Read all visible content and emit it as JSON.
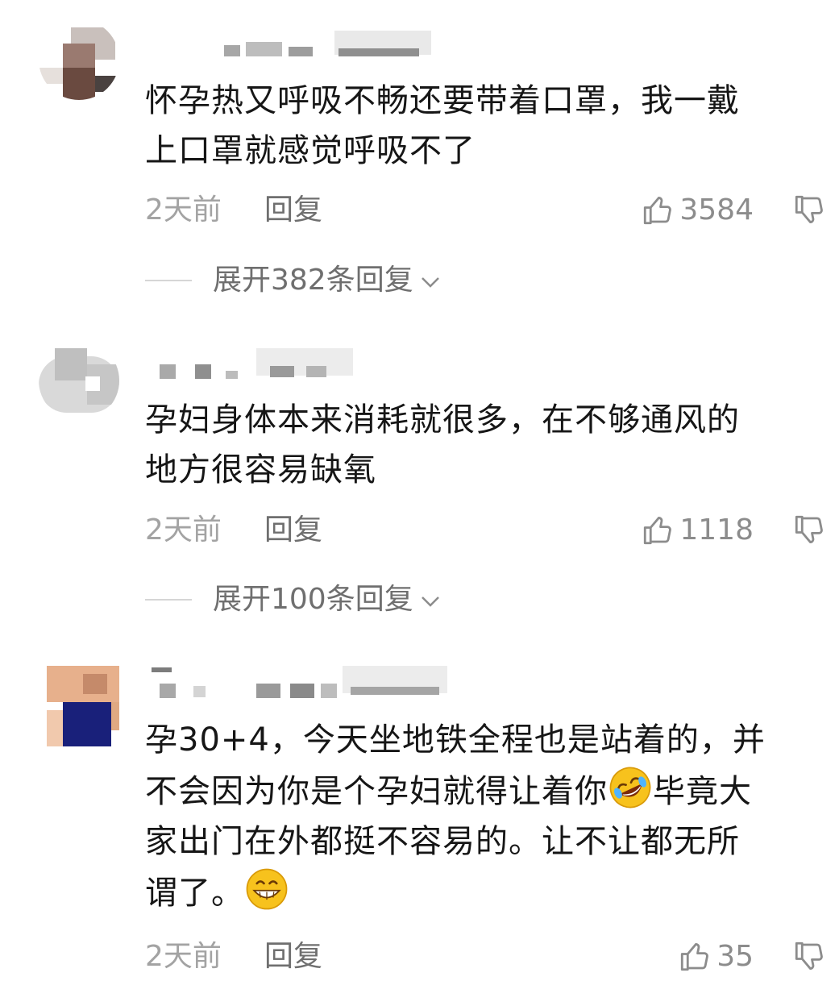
{
  "comments": [
    {
      "text_lines": [
        "怀孕热又呼吸不畅还要带着口罩，我一戴",
        "上口罩就感觉呼吸不了"
      ],
      "time": "2天前",
      "reply_label": "回复",
      "likes": "3584",
      "expand_label": "展开382条回复"
    },
    {
      "text_lines": [
        "孕妇身体本来消耗就很多，在不够通风的",
        "地方很容易缺氧"
      ],
      "time": "2天前",
      "reply_label": "回复",
      "likes": "1118",
      "expand_label": "展开100条回复"
    },
    {
      "text_lines": [
        "孕30+4，今天坐地铁全程也是站着的，并",
        "不会因为你是个孕妇就得让着你",
        "毕竟大",
        "家出门在外都挺不容易的。让不让都无所",
        "谓了。"
      ],
      "time": "2天前",
      "reply_label": "回复",
      "likes": "35"
    }
  ],
  "icons": {
    "like": "thumbs-up-icon",
    "dislike": "thumbs-down-icon",
    "expand": "chevron-down-icon",
    "emoji_laugh": "rolling-laughing-emoji",
    "emoji_grin": "grinning-emoji"
  },
  "colors": {
    "text": "#161616",
    "meta": "#a3a3a3",
    "action": "#6f6f6f",
    "emoji_yellow": "#f7c21d"
  }
}
